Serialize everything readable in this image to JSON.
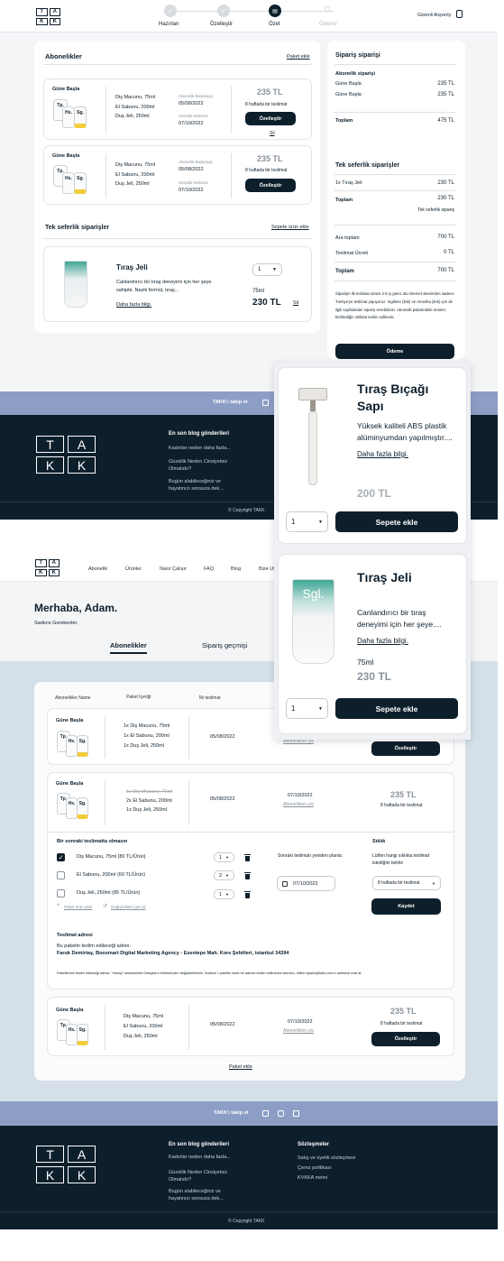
{
  "brand": {
    "letters": [
      "T",
      "A",
      "K",
      "K"
    ]
  },
  "checkout": {
    "steps": [
      {
        "label": "Hazırlan",
        "icon": "check-icon"
      },
      {
        "label": "Özelleştir",
        "icon": "check-icon"
      },
      {
        "label": "Özet",
        "icon": "summary-icon"
      },
      {
        "label": "Ödeme",
        "icon": "payment-icon"
      }
    ],
    "secure": "Güvenli Alışveriş",
    "subs_title": "Abonelikler",
    "add_package": "Paket ekle",
    "sub_cards": [
      {
        "name": "Güne Başla",
        "items": [
          "Diş Macunu, 75ml",
          "El Sabunu, 200ml",
          "Duş Jeli, 250ml"
        ],
        "start_label": "Abonelik Başlangıç",
        "start": "05/08/2022",
        "next_label": "Sonraki teslimat",
        "next": "07/10/2022",
        "price": "235 TL",
        "freq": "8 haftada bir teslimat",
        "button": "Özelleştir",
        "remove": "Sil"
      },
      {
        "name": "Güne Başla",
        "items": [
          "Diş Macunu, 75ml",
          "El Sabunu, 200ml",
          "Duş Jeli, 250ml"
        ],
        "start_label": "Abonelik Başlangıç",
        "start": "05/08/2022",
        "next_label": "Sonraki teslimat",
        "next": "07/10/2022",
        "price": "235 TL",
        "freq": "8 haftada bir teslimat",
        "button": "Özelleştir"
      }
    ],
    "single_title": "Tek seferlik siparişler",
    "add_cart_product": "Sepete ürün ekle",
    "single": {
      "name": "Tıraş Jeli",
      "desc": "Canlandırıcı bir tıraş deneyimi için her şeye sahiptir. Nazik formül, tıraş...",
      "more": "Daha fazla bilgi.",
      "qty": "1",
      "size": "75ml",
      "price": "230 TL",
      "remove": "Sil"
    },
    "summary": {
      "title": "Sipariş siparişi",
      "subs_heading": "Abonelik siparişi",
      "subs_rows": [
        {
          "label": "Güne Başla",
          "value": "235 TL"
        },
        {
          "label": "Güne Başla",
          "value": "235 TL"
        }
      ],
      "subs_total": {
        "label": "Toplam",
        "value": "475 TL"
      },
      "single_heading": "Tek seferlik siparişler",
      "single_row": {
        "label": "1x Tıraş Jeli",
        "value": "230 TL"
      },
      "single_total": {
        "label": "Toplam",
        "value": "230 TL"
      },
      "single_note": "Tek seferlik sipariş",
      "rows": [
        {
          "label": "Ara toplam",
          "value": "700 TL"
        },
        {
          "label": "Teslimat Ücreti",
          "value": "0 TL"
        }
      ],
      "grand": {
        "label": "Toplam",
        "value": "700 TL"
      },
      "note": "Siparişin ilk teslimat süresi 2-5 iş günü. Bu internet sitesinden sadece Türkiye'ye teslimat yapıyoruz. İngiltere (link) ve Amerika (link) için de ilgili sayfalardan sipariş verebilirsin. Abonelik paketindeki ürünler, belirlediğin sıklıkta teslim edilecek.",
      "pay": "Ödeme"
    }
  },
  "popups": [
    {
      "name": "Tıraş Bıçağı Sapı",
      "desc": "Yüksek kaliteli ABS plastik alüminyumdan yapılmıştır....",
      "more": "Daha fazla bilgi.",
      "price": "200 TL",
      "qty": "1",
      "button": "Sepete ekle"
    },
    {
      "name": "Tıraş Jeli",
      "desc": "Canlandırıcı bir tıraş deneyimi için her şeye....",
      "more": "Daha fazla bilgi.",
      "size": "75ml",
      "price": "230 TL",
      "qty": "1",
      "button": "Sepete ekle"
    }
  ],
  "footer": {
    "follow": "TAKK'ı takip et",
    "blog_title": "En son blog gönderileri",
    "blog_links": [
      "Kadınlar neden daha fazla...",
      "Güzellik Neden Cinsiyetsiz Olmalıdır?",
      "Bugün alabileceğiniz ve hayatınızı sonsuza dek..."
    ],
    "contracts_title": "Sözleşmeler",
    "contracts": [
      "Satış ve üyelik sözleşmesi",
      "Çerez politikası",
      "KVKKA metni"
    ],
    "copyright": "© Copyright TAKK"
  },
  "account": {
    "nav": [
      "Abonelik",
      "Ürünler",
      "Nasıl Çalışır",
      "FAQ",
      "Blog",
      "Bize Ulaşın"
    ],
    "greeting": "Merhaba, Adam.",
    "tagline": "Sadece Gerekenler.",
    "tabs": [
      "Abonelikler",
      "Sipariş geçmişi"
    ],
    "headers": [
      "Abonelikler Name",
      "Paket İçeriği",
      "İlk teslimat"
    ],
    "rows": [
      {
        "name": "Güne Başla",
        "items": [
          "1x Diş Macunu, 75ml",
          "1x El Sabunu, 200ml",
          "1x Duş Jeli, 250ml"
        ],
        "first": "05/08/2022",
        "cancel": "Abonelikten çık",
        "button": "Özelleştir"
      },
      {
        "name": "Güne Başla",
        "items": [
          "1x Diş Macunu, 75ml",
          "2x El Sabunu, 200ml",
          "1x Duş Jeli, 250ml"
        ],
        "first": "05/08/2022",
        "next": "07/10/2022",
        "cancel": "Abonelikten çık",
        "price": "235 TL",
        "freq": "8 haftada bir teslimat"
      },
      {
        "name": "Güne Başla",
        "items": [
          "Diş Macunu, 75ml",
          "El Sabunu, 200ml",
          "Duş Jeli, 250ml"
        ],
        "first": "05/08/2022",
        "next": "07/10/2022",
        "cancel": "Abonelikten çık",
        "price": "235 TL",
        "freq": "8 haftada bir teslimat",
        "button": "Özelleştir"
      }
    ],
    "edit": {
      "title": "Bir sonraki teslimatta olmasın",
      "items": [
        {
          "label": "Diş Macunu, 75ml (80 TL/Ürün)",
          "qty": "1",
          "checked": true
        },
        {
          "label": "El Sabunu, 200ml (60 TL/Ürün)",
          "qty": "2",
          "checked": false
        },
        {
          "label": "Duş Jeli, 250ml (85 TL/Ürün)",
          "qty": "1",
          "checked": false
        }
      ],
      "add": "Paket ürün ekle",
      "undo": "Değişiklikleri geri al",
      "next_label": "Sonraki teslimatı yeniden planla:",
      "next_date": "07/10/2022",
      "freq_title": "Sıklık",
      "freq_desc": "Lütfen hangi sıklıkta teslimat istediğini belirle",
      "freq_value": "8 haftada bir teslimat",
      "save": "Kaydet",
      "addr_title": "Teslimat adresi",
      "addr_line": "Bu paketin teslim edileceği adres:",
      "addr": "Faruk Demirtaş, Boosmart Digital Marketing Agency - Esentepe Mah. Kore Şehitleri, istanbul 34394",
      "addr_note": "Paketlerinin teslim edileceği adresi; \"Hesap\" sekmesinde Detayların bölümünden değiştirebilirsin. Sadece 1 paketin farklı bir adrese teslim edilmesini istersen, lütfen siparis@takk.com.tr adresine mail at."
    },
    "add_package": "Paket ekle"
  },
  "colors": {
    "navy": "#0e1f2c",
    "band": "#8d9ec6",
    "bg": "#f5f6f8",
    "teal": "#3fa694"
  }
}
